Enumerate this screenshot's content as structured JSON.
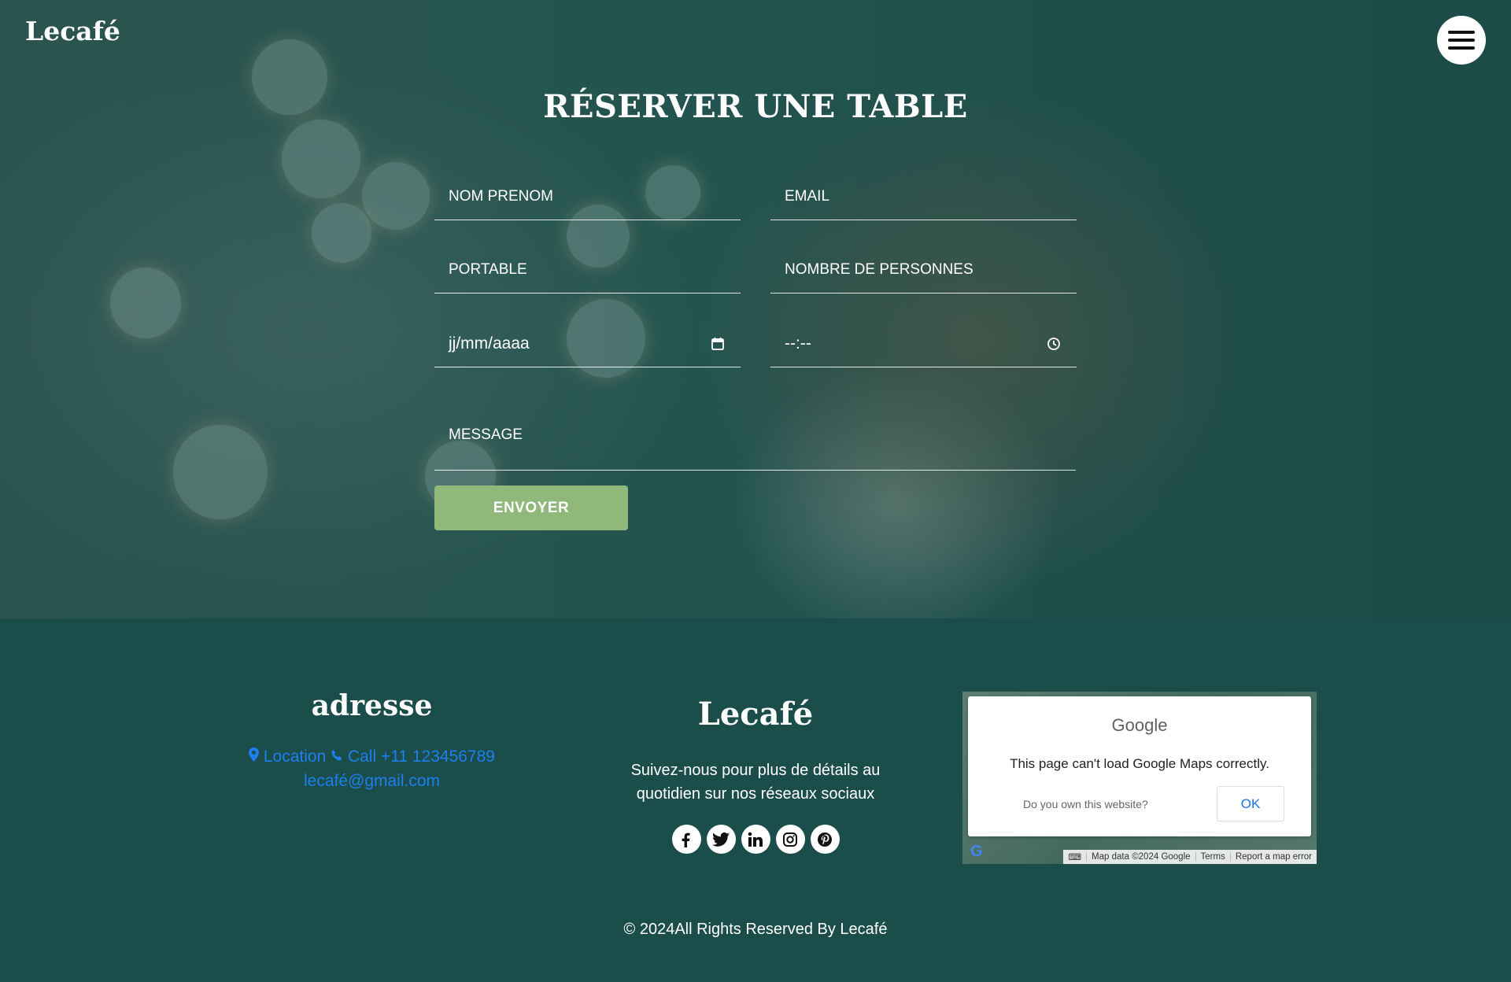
{
  "header": {
    "brand": "Lecafé",
    "menu_icon": "hamburger-icon"
  },
  "reservation": {
    "title": "RÉSERVER UNE TABLE",
    "fields": {
      "name": "NOM PRENOM",
      "email": "EMAIL",
      "phone": "PORTABLE",
      "guests": "NOMBRE DE PERSONNES",
      "date": "jj/mm/aaaa",
      "time": "--:--",
      "message": "MESSAGE"
    },
    "submit": "ENVOYER"
  },
  "footer": {
    "address": {
      "title": "adresse",
      "location": "Location",
      "call": "Call +11 123456789",
      "email": "lecafé@gmail.com"
    },
    "brand": {
      "title": "Lecafé",
      "text": "Suivez-nous pour plus de détails au quotidien sur nos réseaux sociaux",
      "socials": [
        "facebook-icon",
        "twitter-icon",
        "linkedin-icon",
        "instagram-icon",
        "pinterest-icon"
      ]
    },
    "map": {
      "logo": "Google",
      "message": "This page can't load Google Maps correctly.",
      "own_site": "Do you own this website?",
      "ok": "OK",
      "attribution": "Map data ©2024 Google",
      "terms": "Terms",
      "report": "Report a map error"
    },
    "copyright": "© 2024All Rights Reserved By Lecafé"
  },
  "colors": {
    "accent_green": "#8fb87a",
    "footer_bg": "#1b4d4a",
    "link_blue": "#1e7ff0"
  }
}
